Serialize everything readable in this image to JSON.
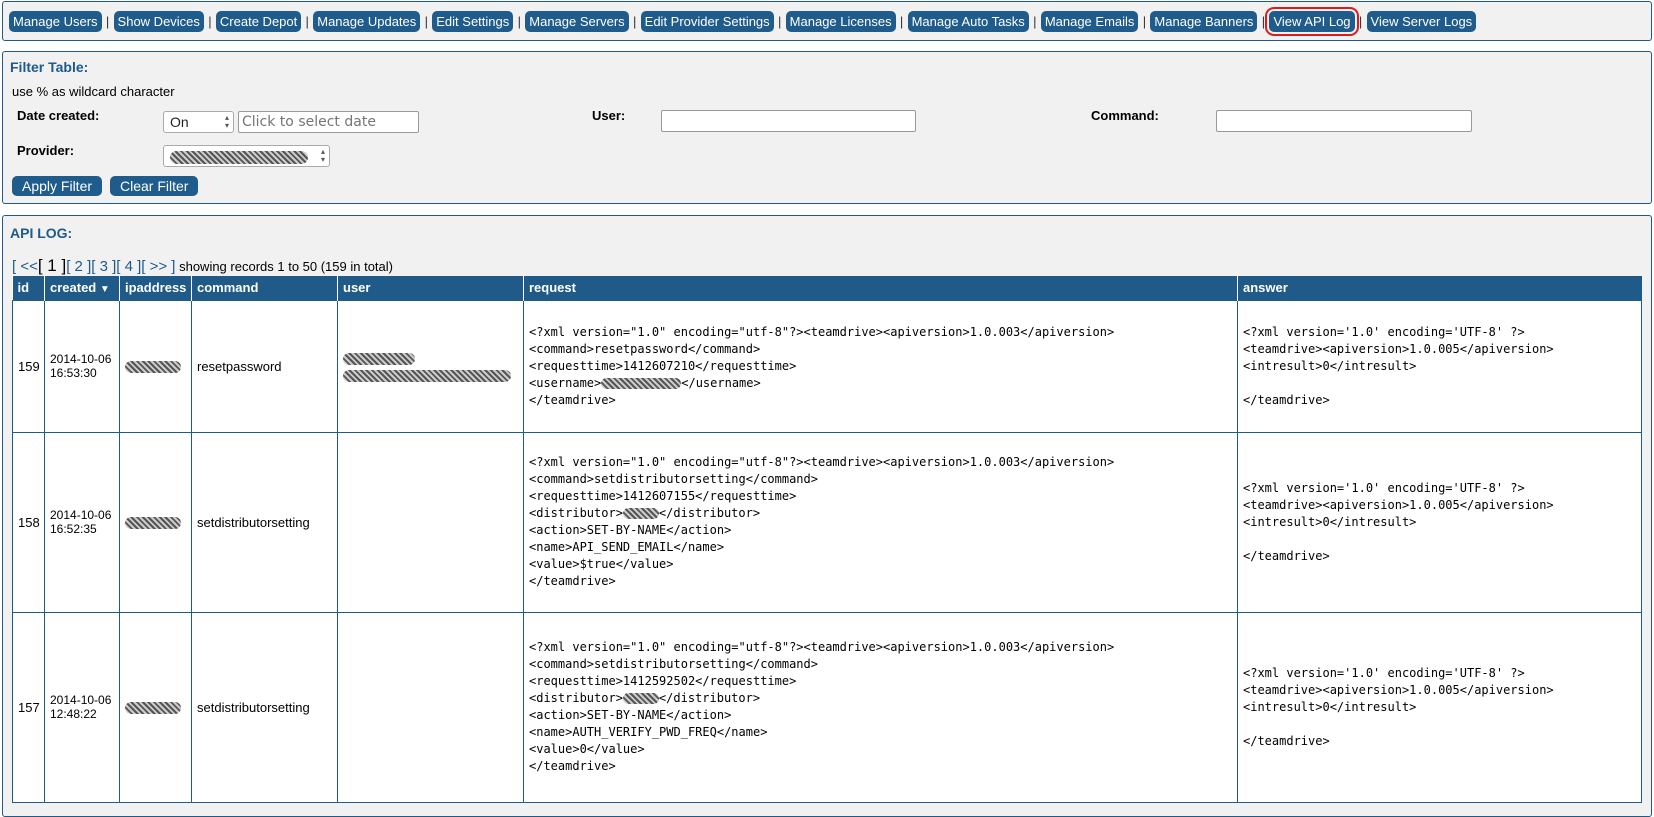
{
  "nav": {
    "items": [
      {
        "label": "Manage Users"
      },
      {
        "label": "Show Devices"
      },
      {
        "label": "Create Depot"
      },
      {
        "label": "Manage Updates"
      },
      {
        "label": "Edit Settings"
      },
      {
        "label": "Manage Servers"
      },
      {
        "label": "Edit Provider Settings"
      },
      {
        "label": "Manage Licenses"
      },
      {
        "label": "Manage Auto Tasks"
      },
      {
        "label": "Manage Emails"
      },
      {
        "label": "Manage Banners"
      },
      {
        "label": "View API Log",
        "selected": true
      },
      {
        "label": "View Server Logs"
      }
    ],
    "separator": "|"
  },
  "filter": {
    "title": "Filter Table:",
    "hint": "use % as wildcard character",
    "date_label": "Date created:",
    "date_mode": "On",
    "date_placeholder": "Click to select date",
    "user_label": "User:",
    "user_value": "",
    "command_label": "Command:",
    "command_value": "",
    "provider_label": "Provider:",
    "apply_label": "Apply Filter",
    "clear_label": "Clear Filter"
  },
  "log": {
    "title": "API LOG:",
    "pager": {
      "first": "[ <<",
      "current": "[ 1 ]",
      "pages": [
        "[ 2 ]",
        "[ 3 ]",
        "[ 4 ]"
      ],
      "next": "[ >> ]",
      "summary": "showing records 1 to 50 (159 in total)"
    },
    "columns": [
      "id",
      "created",
      "ipaddress",
      "command",
      "user",
      "request",
      "answer"
    ],
    "sort_indicator": "▼",
    "rows": [
      {
        "id": "159",
        "created": "2014-10-06\n16:53:30",
        "command": "resetpassword",
        "request": "<?xml version=\"1.0\" encoding=\"utf-8\"?><teamdrive><apiversion>1.0.003</apiversion>\n<command>resetpassword</command>\n<requesttime>1412607210</requesttime>\n<username>",
        "request_tail": "</username>\n</teamdrive>",
        "answer": "<?xml version='1.0' encoding='UTF-8' ?>\n<teamdrive><apiversion>1.0.005</apiversion>\n<intresult>0</intresult>\n\n</teamdrive>"
      },
      {
        "id": "158",
        "created": "2014-10-06\n16:52:35",
        "command": "setdistributorsetting",
        "request": "<?xml version=\"1.0\" encoding=\"utf-8\"?><teamdrive><apiversion>1.0.003</apiversion>\n<command>setdistributorsetting</command>\n<requesttime>1412607155</requesttime>\n<distributor>",
        "request_tail": "</distributor>\n<action>SET-BY-NAME</action>\n<name>API_SEND_EMAIL</name>\n<value>$true</value>\n</teamdrive>",
        "answer": "<?xml version='1.0' encoding='UTF-8' ?>\n<teamdrive><apiversion>1.0.005</apiversion>\n<intresult>0</intresult>\n\n</teamdrive>"
      },
      {
        "id": "157",
        "created": "2014-10-06\n12:48:22",
        "command": "setdistributorsetting",
        "request": "<?xml version=\"1.0\" encoding=\"utf-8\"?><teamdrive><apiversion>1.0.003</apiversion>\n<command>setdistributorsetting</command>\n<requesttime>1412592502</requesttime>\n<distributor>",
        "request_tail": "</distributor>\n<action>SET-BY-NAME</action>\n<name>AUTH_VERIFY_PWD_FREQ</name>\n<value>0</value>\n</teamdrive>",
        "answer": "<?xml version='1.0' encoding='UTF-8' ?>\n<teamdrive><apiversion>1.0.005</apiversion>\n<intresult>0</intresult>\n\n</teamdrive>"
      }
    ]
  },
  "colors": {
    "accent": "#1f5c8b",
    "panel_bg": "#f1f1f1",
    "selected_outline": "#e01a1a"
  }
}
